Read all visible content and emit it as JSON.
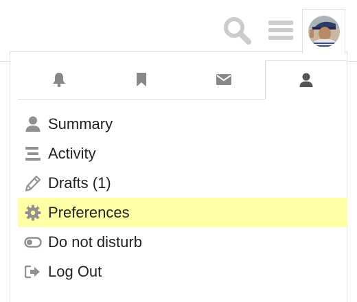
{
  "header": {
    "search_icon": "search-icon",
    "menu_icon": "hamburger-icon",
    "avatar_icon": "user-avatar"
  },
  "colors": {
    "icon_gray": "#cccccc",
    "tab_icon": "#888888",
    "active_tab_icon": "#555555",
    "menu_icon": "#919191",
    "highlight": "#ffffa6",
    "border": "#e0e0e0"
  },
  "tabs": [
    {
      "icon": "bell-icon",
      "active": false
    },
    {
      "icon": "bookmark-icon",
      "active": false
    },
    {
      "icon": "envelope-icon",
      "active": false
    },
    {
      "icon": "user-icon",
      "active": true
    }
  ],
  "menu": {
    "items": [
      {
        "label": "Summary",
        "icon": "user-icon",
        "highlighted": false
      },
      {
        "label": "Activity",
        "icon": "stream-icon",
        "highlighted": false
      },
      {
        "label": "Drafts (1)",
        "icon": "pencil-icon",
        "highlighted": false
      },
      {
        "label": "Preferences",
        "icon": "gear-icon",
        "highlighted": true
      },
      {
        "label": "Do not disturb",
        "icon": "toggle-off-icon",
        "highlighted": false
      },
      {
        "label": "Log Out",
        "icon": "sign-out-icon",
        "highlighted": false
      }
    ]
  }
}
